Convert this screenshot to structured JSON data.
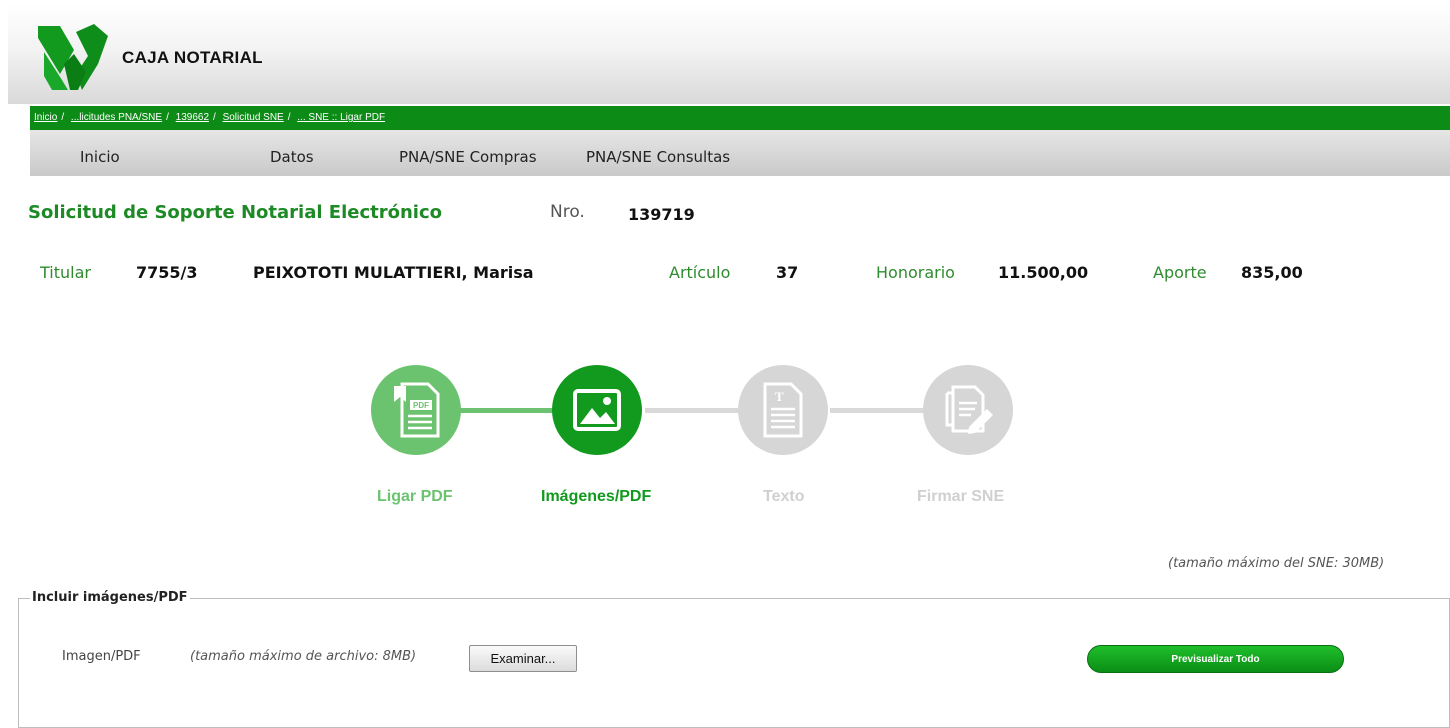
{
  "brand": {
    "name": "CAJA NOTARIAL",
    "colors": {
      "primary": "#0d8b17",
      "step_active": "#119a1e",
      "step_done": "#6cc36f",
      "step_inactive": "#d6d6d6"
    }
  },
  "breadcrumb": [
    {
      "label": "Inicio"
    },
    {
      "label": "...licitudes PNA/SNE"
    },
    {
      "label": "139662"
    },
    {
      "label": "Solicitud SNE"
    },
    {
      "label": "... SNE :: Ligar PDF"
    }
  ],
  "menu": [
    "Inicio",
    "Datos",
    "PNA/SNE Compras",
    "PNA/SNE Consultas"
  ],
  "page": {
    "title": "Solicitud de Soporte Notarial Electrónico",
    "nro_label": "Nro.",
    "nro_value": "139719"
  },
  "info": {
    "titular_label": "Titular",
    "titular_code": "7755/3",
    "titular_name": "PEIXOTOTI MULATTIERI, Marisa",
    "articulo_label": "Artículo",
    "articulo_value": "37",
    "honorario_label": "Honorario",
    "honorario_value": "11.500,00",
    "aporte_label": "Aporte",
    "aporte_value": "835,00"
  },
  "steps": [
    {
      "label": "Ligar PDF",
      "icon": "pdf-document-icon",
      "state": "done"
    },
    {
      "label": "Imágenes/PDF",
      "icon": "image-icon",
      "state": "active"
    },
    {
      "label": "Texto",
      "icon": "text-document-icon",
      "state": "inactive"
    },
    {
      "label": "Firmar SNE",
      "icon": "sign-document-icon",
      "state": "inactive"
    }
  ],
  "max_size_note": "(tamaño máximo del SNE: 30MB)",
  "upload": {
    "legend": "Incluir imágenes/PDF",
    "field_label": "Imagen/PDF",
    "field_hint": "(tamaño máximo de archivo: 8MB)",
    "browse_label": "Examinar...",
    "preview_label": "Previsualizar Todo"
  }
}
